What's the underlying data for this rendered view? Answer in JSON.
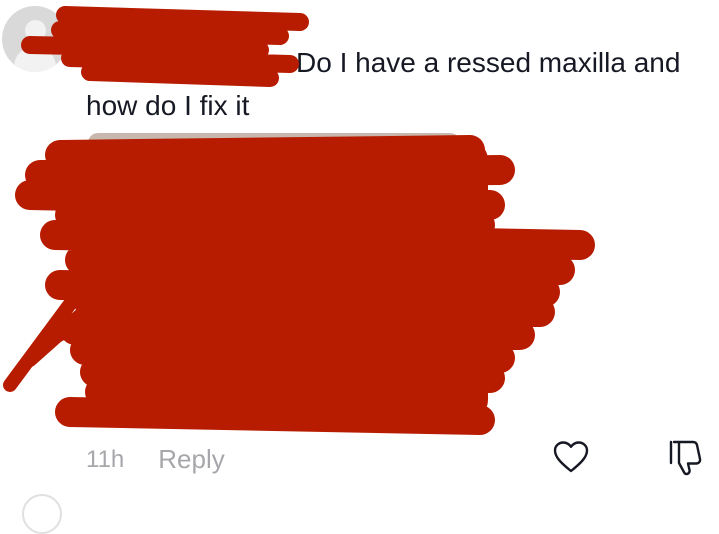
{
  "comment": {
    "text_line1": "Do I have a ressed maxilla and",
    "text_line2": "how do I fix it",
    "time": "11h",
    "reply_label": "Reply"
  },
  "icons": {
    "avatar": "default-avatar-icon",
    "like": "heart-outline-icon",
    "dislike": "thumbs-down-outline-icon"
  },
  "colors": {
    "redaction": "#b81c00",
    "meta_text": "#a7a7ab"
  }
}
